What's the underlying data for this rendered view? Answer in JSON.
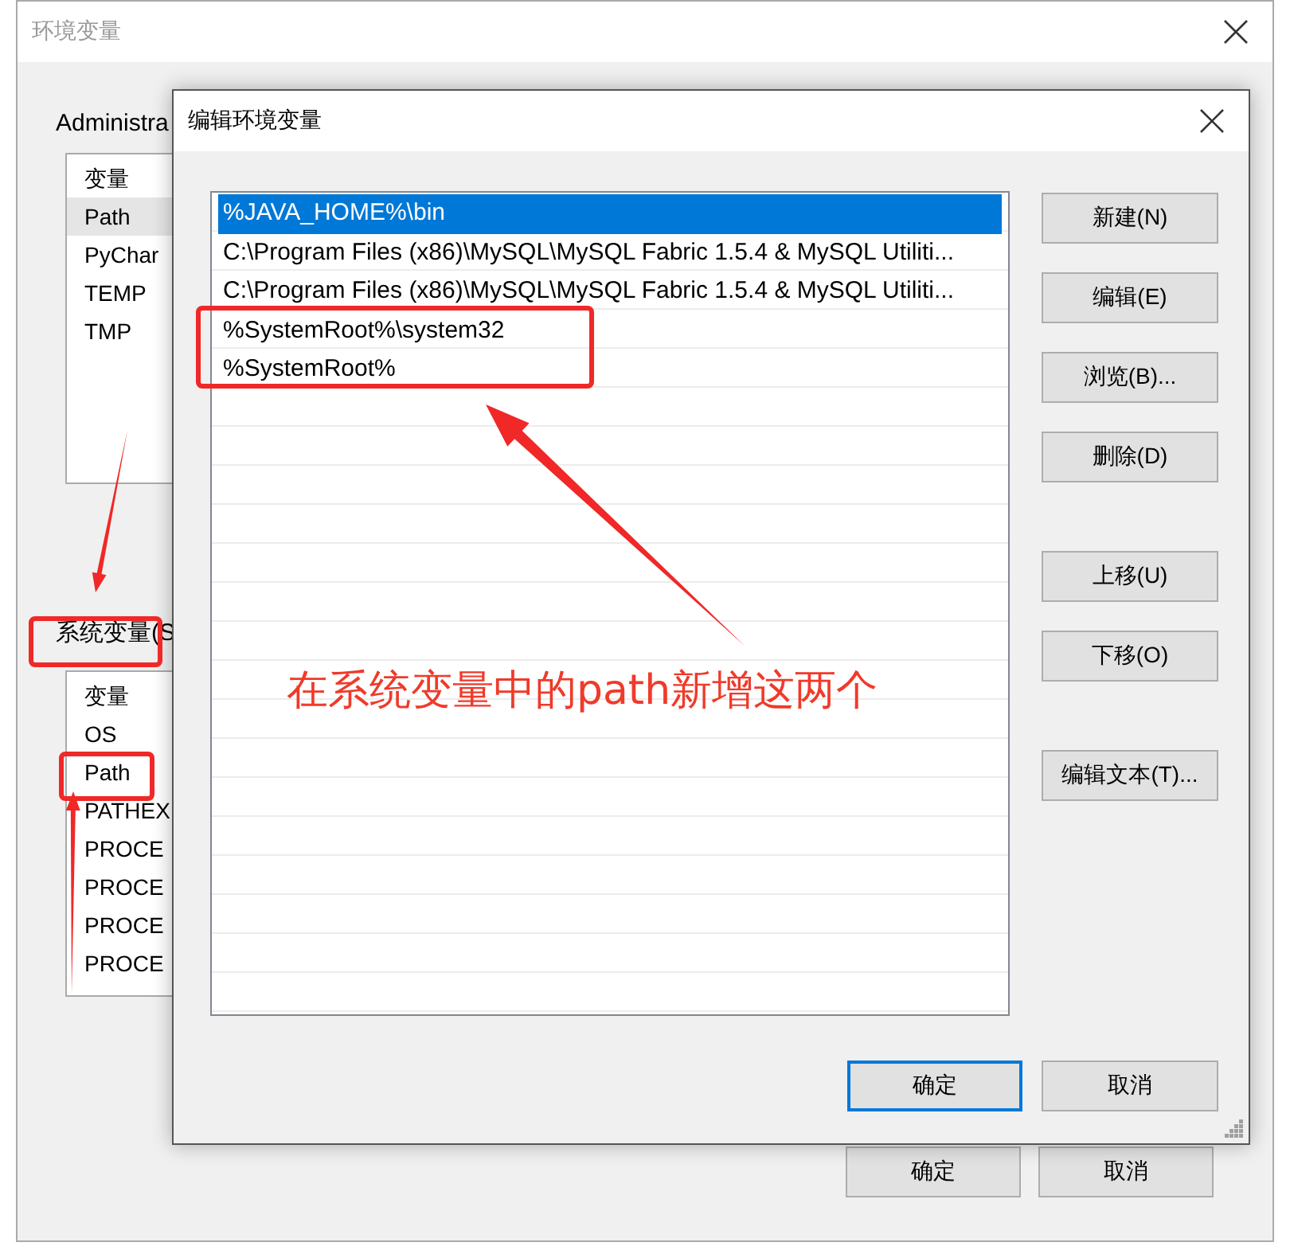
{
  "back_window": {
    "title": "环境变量",
    "user_group": {
      "label": "Administra",
      "header": "变量",
      "rows": [
        {
          "name": "Path",
          "selected": true
        },
        {
          "name": "PyChar",
          "selected": false
        },
        {
          "name": "TEMP",
          "selected": false
        },
        {
          "name": "TMP",
          "selected": false
        }
      ]
    },
    "system_group": {
      "label": "系统变量(S",
      "header": "变量",
      "rows": [
        {
          "name": "OS",
          "selected": false
        },
        {
          "name": "Path",
          "selected": false
        },
        {
          "name": "PATHEX",
          "selected": false
        },
        {
          "name": "PROCE",
          "selected": false
        },
        {
          "name": "PROCE",
          "selected": false
        },
        {
          "name": "PROCE",
          "selected": false
        },
        {
          "name": "PROCE",
          "selected": false
        }
      ]
    },
    "buttons": [
      {
        "label": "确定",
        "default": false
      },
      {
        "label": "取消",
        "default": false
      }
    ]
  },
  "edit_dialog": {
    "title": "编辑环境变量",
    "entries": [
      {
        "text": "%JAVA_HOME%\\bin",
        "selected": true
      },
      {
        "text": "C:\\Program Files (x86)\\MySQL\\MySQL Fabric 1.5.4 & MySQL Utiliti...",
        "selected": false
      },
      {
        "text": "C:\\Program Files (x86)\\MySQL\\MySQL Fabric 1.5.4 & MySQL Utiliti...",
        "selected": false
      },
      {
        "text": "%SystemRoot%\\system32",
        "selected": false
      },
      {
        "text": "%SystemRoot%",
        "selected": false
      }
    ],
    "side_buttons": [
      [
        "新建(N)",
        "编辑(E)",
        "浏览(B)...",
        "删除(D)"
      ],
      [
        "上移(U)",
        "下移(O)"
      ],
      [
        "编辑文本(T)..."
      ]
    ],
    "buttons": [
      {
        "label": "确定",
        "default": true
      },
      {
        "label": "取消",
        "default": false
      }
    ]
  },
  "annotation": {
    "text": "在系统变量中的path新增这两个"
  }
}
